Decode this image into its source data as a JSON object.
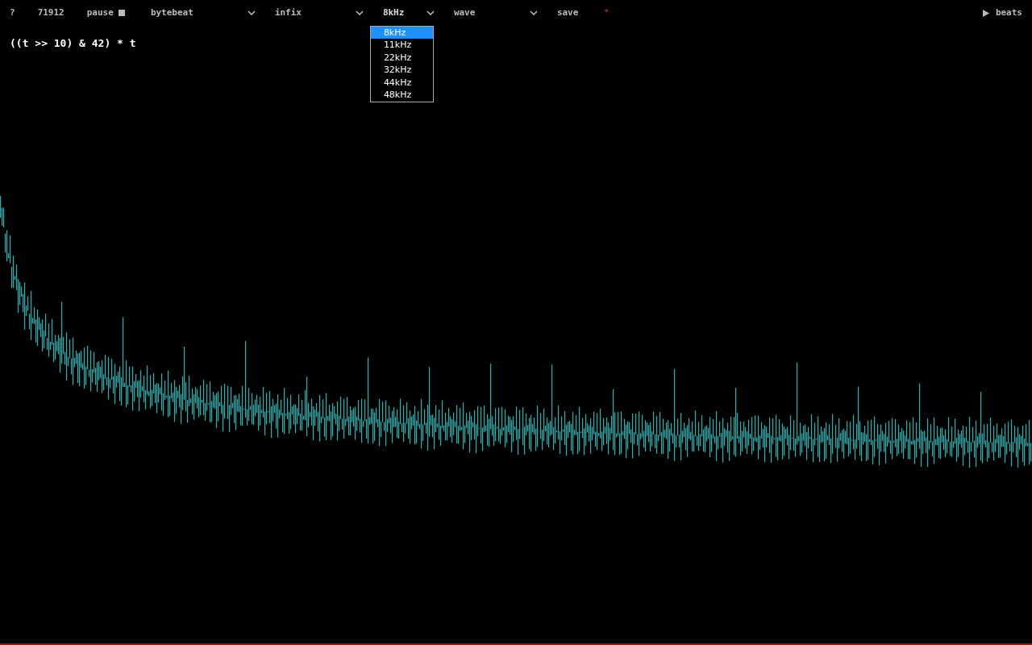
{
  "toolbar": {
    "help": "?",
    "counter": "71912",
    "pause": "pause",
    "selects": [
      {
        "value": "bytebeat",
        "open": false
      },
      {
        "value": "infix",
        "open": false
      },
      {
        "value": "8kHz",
        "open": true
      },
      {
        "value": "wave",
        "open": false
      }
    ],
    "save": "save",
    "modified": "*",
    "beats": "beats"
  },
  "dropdown": {
    "options": [
      {
        "label": "8kHz",
        "selected": true
      },
      {
        "label": "11kHz",
        "selected": false
      },
      {
        "label": "22kHz",
        "selected": false
      },
      {
        "label": "32kHz",
        "selected": false
      },
      {
        "label": "44kHz",
        "selected": false
      },
      {
        "label": "48kHz",
        "selected": false
      }
    ]
  },
  "expression": "((t >> 10) & 42) * t"
}
